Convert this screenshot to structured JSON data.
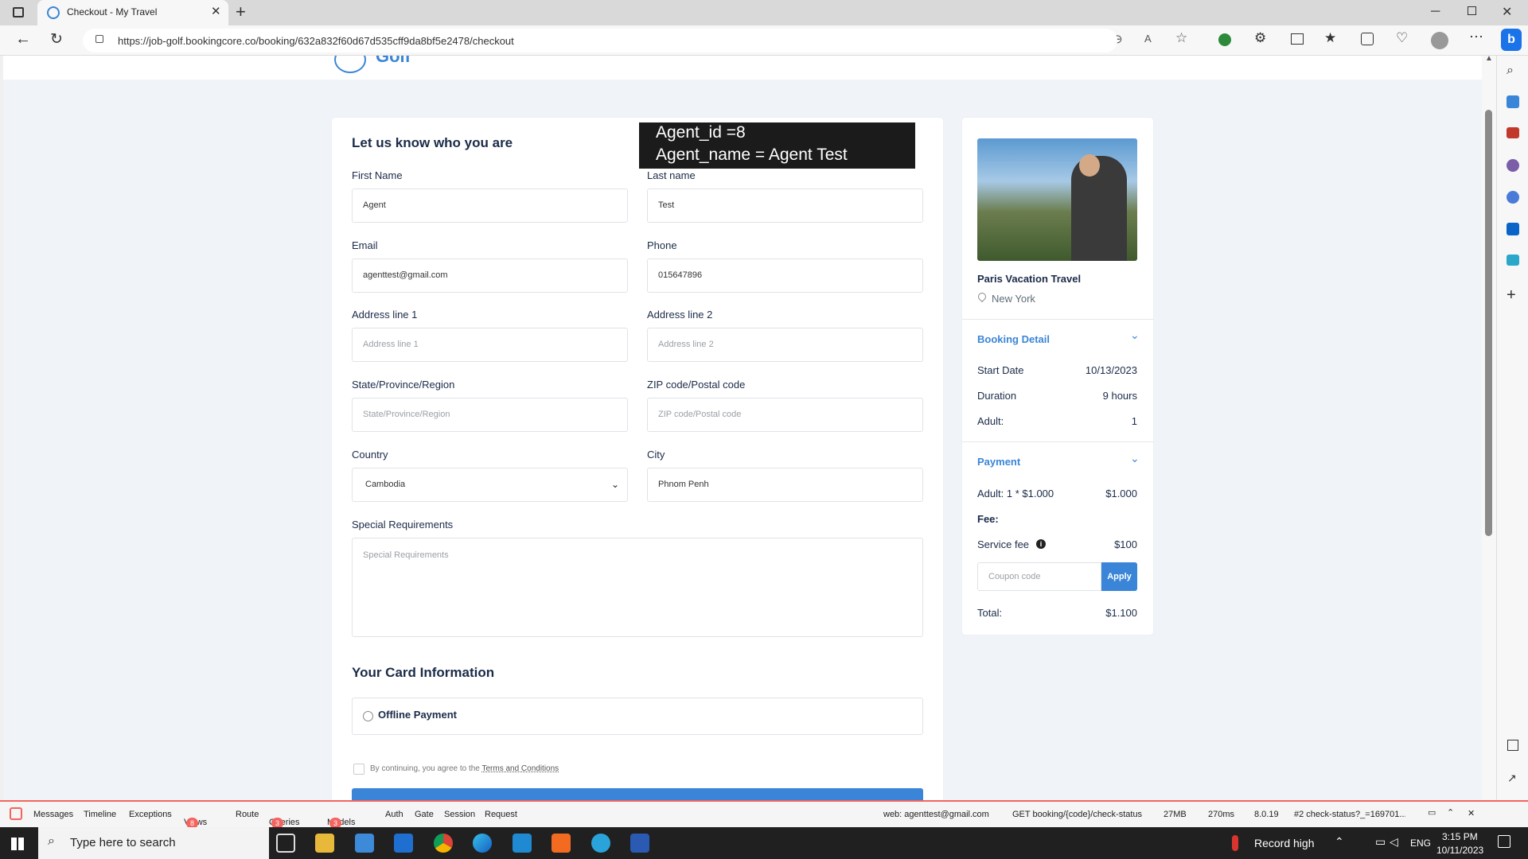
{
  "browser": {
    "tab_title": "Checkout - My Travel",
    "url": "https://job-golf.bookingcore.co/booking/632a832f60d67d535cff9da8bf5e2478/checkout"
  },
  "overlay": {
    "line1": "Agent_id =8",
    "line2": "Agent_name = Agent Test"
  },
  "logo": {
    "text": "Golf"
  },
  "form": {
    "heading": "Let us know who you are",
    "first_name": {
      "label": "First Name",
      "value": "Agent"
    },
    "last_name": {
      "label": "Last name",
      "value": "Test"
    },
    "email": {
      "label": "Email",
      "value": "agenttest@gmail.com"
    },
    "phone": {
      "label": "Phone",
      "value": "015647896"
    },
    "address1": {
      "label": "Address line 1",
      "placeholder": "Address line 1"
    },
    "address2": {
      "label": "Address line 2",
      "placeholder": "Address line 2"
    },
    "state": {
      "label": "State/Province/Region",
      "placeholder": "State/Province/Region"
    },
    "zip": {
      "label": "ZIP code/Postal code",
      "placeholder": "ZIP code/Postal code"
    },
    "country": {
      "label": "Country",
      "value": "Cambodia"
    },
    "city": {
      "label": "City",
      "value": "Phnom Penh"
    },
    "special": {
      "label": "Special Requirements",
      "placeholder": "Special Requirements"
    },
    "card_heading": "Your Card Information",
    "payment_option": "Offline Payment",
    "terms_prefix": "By continuing, you agree to the ",
    "terms_link": "Terms and Conditions"
  },
  "summary": {
    "title": "Paris Vacation Travel",
    "location": "New York",
    "booking_detail": "Booking Detail",
    "start_date_label": "Start Date",
    "start_date": "10/13/2023",
    "duration_label": "Duration",
    "duration": "9 hours",
    "adult_label": "Adult:",
    "adult": "1",
    "payment": "Payment",
    "adult_calc": "Adult: 1 * $1.000",
    "adult_total": "$1.000",
    "fee_label": "Fee:",
    "service_fee_label": "Service fee",
    "service_fee": "$100",
    "coupon_placeholder": "Coupon code",
    "apply": "Apply",
    "total_label": "Total:",
    "total": "$1.100"
  },
  "debugbar": {
    "messages": "Messages",
    "timeline": "Timeline",
    "exceptions": "Exceptions",
    "views": "Views",
    "views_count": "8",
    "route": "Route",
    "queries": "Queries",
    "queries_count": "3",
    "models": "Models",
    "models_count": "3",
    "auth": "Auth",
    "gate": "Gate",
    "session": "Session",
    "request": "Request",
    "user": "web: agenttest@gmail.com",
    "req": "GET booking/{code}/check-status",
    "mem": "27MB",
    "time": "270ms",
    "ver": "8.0.19",
    "hist": "#2 check-status?_=169701..."
  },
  "taskbar": {
    "search_placeholder": "Type here to search",
    "weather": "Record high",
    "lang": "ENG",
    "time": "3:15 PM",
    "date": "10/11/2023"
  },
  "colors": {
    "accent": "#3a85d7",
    "debug": "#f4645f"
  }
}
